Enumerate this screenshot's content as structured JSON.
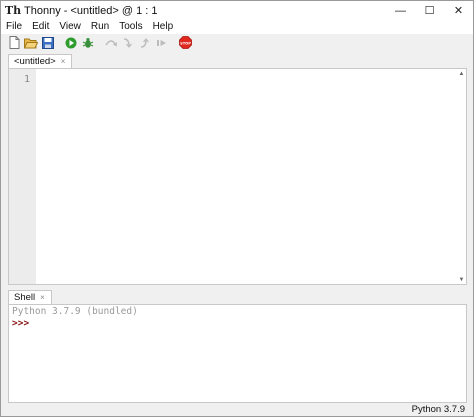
{
  "window": {
    "app_icon": "Th",
    "title": "Thonny  -  <untitled>  @  1 : 1",
    "controls": {
      "minimize": "—",
      "maximize": "☐",
      "close": "✕"
    }
  },
  "menu": [
    "File",
    "Edit",
    "View",
    "Run",
    "Tools",
    "Help"
  ],
  "toolbar": {
    "icons": [
      "new-file-icon",
      "open-folder-icon",
      "save-icon",
      "run-icon",
      "debug-icon",
      "step-over-icon",
      "step-into-icon",
      "step-out-icon",
      "resume-icon",
      "stop-icon"
    ],
    "stop_label": "STOP"
  },
  "editor": {
    "tab_label": "<untitled>",
    "tab_close": "×",
    "line_numbers": [
      "1"
    ]
  },
  "shell": {
    "tab_label": "Shell",
    "tab_close": "×",
    "banner": "Python 3.7.9 (bundled)",
    "prompt": ">>>"
  },
  "status": {
    "interpreter": "Python 3.7.9"
  },
  "colors": {
    "run_green": "#2e9d2e",
    "stop_red": "#e0281e",
    "prompt_red": "#8b1a1a"
  }
}
